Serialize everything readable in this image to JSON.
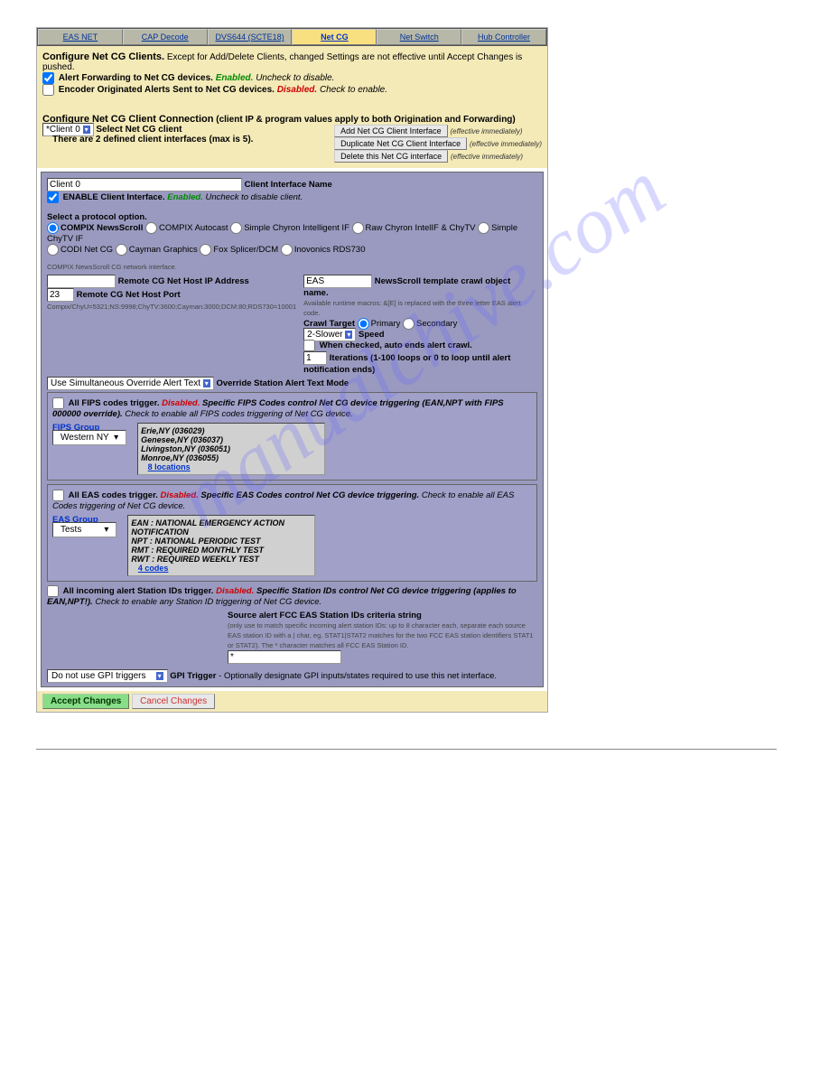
{
  "watermark": "manualchive.com",
  "tabs": [
    {
      "label": "EAS NET",
      "active": false
    },
    {
      "label": "CAP Decode",
      "active": false
    },
    {
      "label": "DVS644 (SCTE18)",
      "active": false
    },
    {
      "label": "Net CG",
      "active": true
    },
    {
      "label": "Net Switch",
      "active": false
    },
    {
      "label": "Hub Controller",
      "active": false
    }
  ],
  "section1": {
    "title": "Configure Net CG Clients.",
    "subtitle": "Except for Add/Delete Clients, changed Settings are not effective until Accept Changes is pushed.",
    "fwd_label": "Alert Forwarding to Net CG devices.",
    "fwd_state": "Enabled.",
    "fwd_hint": "Uncheck to disable.",
    "enc_label": "Encoder Originated Alerts Sent to Net CG devices.",
    "enc_state": "Disabled.",
    "enc_hint": "Check to enable."
  },
  "section2": {
    "title": "Configure Net CG Client Connection",
    "subtitle": "(client IP & program values apply to both Origination and Forwarding)",
    "client_select": "*Client 0",
    "client_select_label": "Select Net CG client",
    "count_msg": "There are 2 defined client interfaces (max is 5).",
    "btn_add": "Add Net CG Client Interface",
    "btn_dup": "Duplicate Net CG Client Interface",
    "btn_del": "Delete this Net CG interface",
    "eff_note": "(effective immediately)"
  },
  "blue": {
    "iface_name": "Client 0",
    "iface_label": "Client Interface Name",
    "enable_label": "ENABLE Client Interface.",
    "enable_state": "Enabled.",
    "enable_hint": "Uncheck to disable client.",
    "proto_heading": "Select a protocol option.",
    "protos": [
      "COMPIX NewsScroll",
      "COMPIX Autocast",
      "Simple Chyron Intelligent IF",
      "Raw Chyron IntelIF & ChyTV",
      "Simple ChyTV IF",
      "CODI Net CG",
      "Cayman Graphics",
      "Fox Splicer/DCM",
      "Inovonics RDS730"
    ],
    "net_note": "COMPIX NewsScroll CG network interface.",
    "host_ip_label": "Remote CG Net Host IP Address",
    "host_ip": "",
    "host_port_label": "Remote CG Net Host Port",
    "host_port": "23",
    "port_note": "Compix/ChyU=5321;NS:9998;ChyTV:3600;Cayman:3000;DCM:80;RDS730=10001",
    "object_name": "EAS",
    "object_label": "NewsScroll template crawl object name.",
    "object_note": "Available runtime macros: &[E] is replaced with the three letter EAS alert code.",
    "crawl_target": "Crawl Target",
    "primary": "Primary",
    "secondary": "Secondary",
    "speed_sel": "2-Slower",
    "speed_label": "Speed",
    "autoend": "When checked, auto ends alert crawl.",
    "iterations": "1",
    "iter_label": "Iterations (1-100 loops or 0 to loop until alert notification ends)",
    "override_sel": "Use Simultaneous Override Alert Text",
    "override_label": "Override Station Alert Text Mode",
    "fips": {
      "line": "All FIPS codes trigger.",
      "state": "Disabled.",
      "rest": "Specific FIPS Codes control Net CG device triggering (EAN,NPT with FIPS 000000 override).",
      "hint": "Check to enable all FIPS codes triggering of Net CG device.",
      "group_label": "FIPS Group",
      "group_sel": "Western NY",
      "items": [
        "Erie,NY (036029)",
        "Genesee,NY (036037)",
        "Livingston,NY (036051)",
        "Monroe,NY (036055)"
      ],
      "count_link": "8 locations"
    },
    "eas": {
      "line": "All EAS codes trigger.",
      "state": "Disabled.",
      "rest": "Specific EAS Codes control Net CG device triggering.",
      "hint": "Check to enable all EAS Codes triggering of Net CG device.",
      "group_label": "EAS Group",
      "group_sel": "Tests",
      "items": [
        "EAN : NATIONAL EMERGENCY ACTION NOTIFICATION",
        "NPT : NATIONAL PERIODIC TEST",
        "RMT : REQUIRED MONTHLY TEST",
        "RWT : REQUIRED WEEKLY TEST"
      ],
      "count_link": "4 codes"
    },
    "station": {
      "line": "All incoming alert Station IDs trigger.",
      "state": "Disabled.",
      "rest": "Specific Station IDs control Net CG device triggering (applies to EAN,NPT!).",
      "hint": "Check to enable any Station ID triggering of Net CG device.",
      "src_label": "Source alert FCC EAS Station IDs criteria string",
      "src_note1": "(only use to match specific incoming alert station IDs: up to 8 character each, separate each source EAS station ID with a | char, eg. STAT1|STAT2 matches for the two FCC EAS station identifiers STAT1 or STAT2). The * character matches all FCC EAS Station ID.",
      "src_val": "*"
    },
    "gpi_sel": "Do not use GPI triggers",
    "gpi_label": "GPI Trigger",
    "gpi_hint": "- Optionally designate GPI inputs/states required to use this net interface."
  },
  "footer": {
    "accept": "Accept Changes",
    "cancel": "Cancel Changes"
  }
}
